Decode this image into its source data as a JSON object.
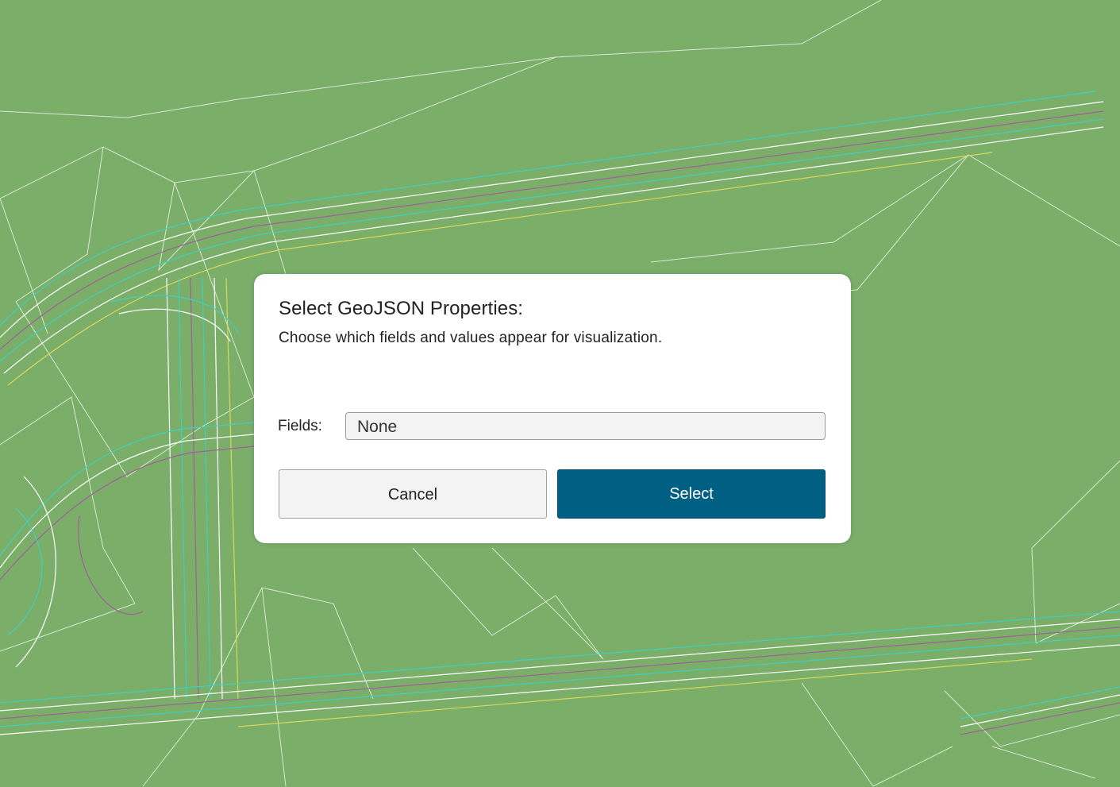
{
  "dialog": {
    "title": "Select GeoJSON Properties:",
    "subtitle": "Choose which fields and values appear for visualization.",
    "fields_label": "Fields:",
    "fields_value": "None",
    "cancel_label": "Cancel",
    "select_label": "Select"
  },
  "colors": {
    "map_background": "#7aae69",
    "primary_button": "#006084",
    "line_white": "#ffffff",
    "line_cyan": "#3fcfbf",
    "line_purple": "#a0609a",
    "line_yellow": "#d8d85a"
  }
}
